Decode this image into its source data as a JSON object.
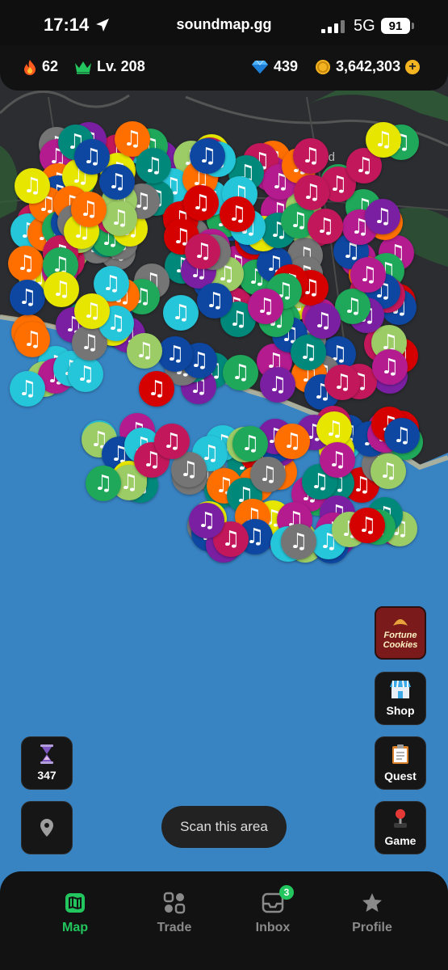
{
  "status_bar": {
    "time": "17:14",
    "url": "soundmap.gg",
    "network": "5G",
    "battery": "91"
  },
  "hud": {
    "streak": "62",
    "level": "Lv. 208",
    "gems": "439",
    "coins": "3,642,303"
  },
  "map": {
    "road_label": "Bear Rd",
    "pin_icon": "music-note",
    "pin_colors": [
      "#1fa85a",
      "#0d47a1",
      "#b31b8f",
      "#e6e600",
      "#c2185b",
      "#ff6f00",
      "#757575",
      "#26c6da",
      "#00897b",
      "#d50000",
      "#7b1fa2",
      "#9ccc65"
    ]
  },
  "buttons": {
    "fortune": "Fortune Cookies",
    "shop": "Shop",
    "quest": "Quest",
    "game": "Game",
    "timer": "347",
    "scan": "Scan this area"
  },
  "nav": {
    "map": "Map",
    "trade": "Trade",
    "inbox": "Inbox",
    "inbox_badge": "3",
    "profile": "Profile"
  },
  "colors": {
    "accent": "#22c55e",
    "water": "#3883c2",
    "land": "#2b2d31"
  }
}
